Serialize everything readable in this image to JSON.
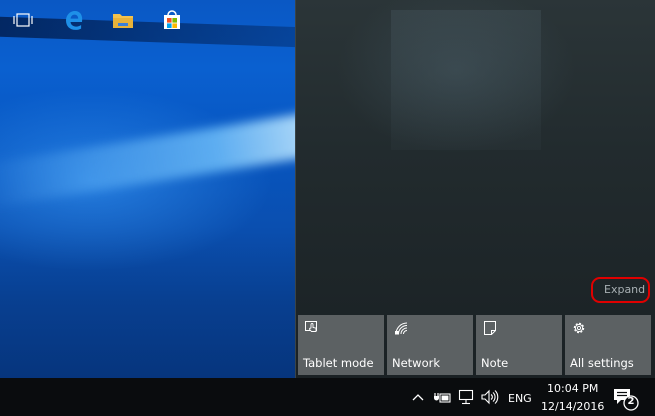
{
  "action_center": {
    "expand_label": "Expand",
    "tiles": [
      {
        "label": "Tablet mode",
        "icon": "tablet-mode-icon"
      },
      {
        "label": "Network",
        "icon": "network-icon"
      },
      {
        "label": "Note",
        "icon": "note-icon"
      },
      {
        "label": "All settings",
        "icon": "settings-gear-icon"
      }
    ]
  },
  "taskbar": {
    "apps": [
      "task-view-icon",
      "edge-icon",
      "file-explorer-icon",
      "store-icon"
    ],
    "tray": {
      "language": "ENG",
      "time": "10:04 PM",
      "date": "12/14/2016",
      "notification_count": "2"
    }
  },
  "colors": {
    "highlight_ring": "#e00000",
    "tile_bg": "#5c6163",
    "taskbar_bg": "#0a0c0e",
    "edge_blue": "#1e90e8",
    "folder_yellow": "#f2c24e"
  }
}
